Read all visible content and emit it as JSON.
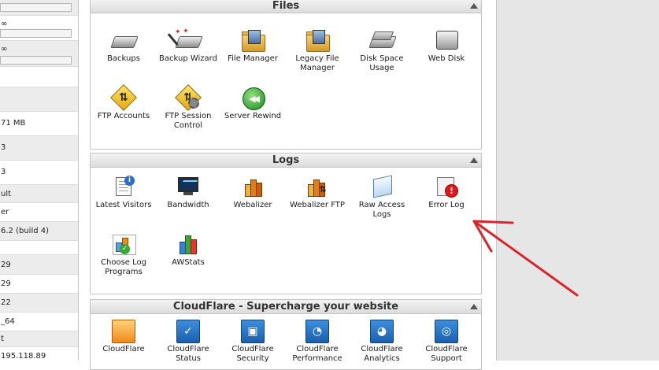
{
  "sidebar": {
    "rows": [
      {
        "text": "",
        "bar": 0.0
      },
      {
        "text": "∞",
        "bar": 0.0
      },
      {
        "text": "∞",
        "bar": 0.0
      },
      {
        "text": ""
      },
      {
        "text": ""
      },
      {
        "text": "71 MB"
      },
      {
        "text": "3"
      },
      {
        "text": "3"
      },
      {
        "text": "ult"
      },
      {
        "text": "er"
      },
      {
        "text": "6.2 (build 4)"
      },
      {
        "text": ""
      },
      {
        "text": "29"
      },
      {
        "text": "29"
      },
      {
        "text": "22"
      },
      {
        "text": "_64"
      },
      {
        "text": "t"
      },
      {
        "text": "195.118.89"
      }
    ]
  },
  "files": {
    "title": "Files",
    "items": [
      {
        "label": "Backups",
        "icon": "backups-icon"
      },
      {
        "label": "Backup Wizard",
        "icon": "backup-wizard-icon"
      },
      {
        "label": "File Manager",
        "icon": "file-manager-icon"
      },
      {
        "label": "Legacy File Manager",
        "icon": "legacy-file-manager-icon"
      },
      {
        "label": "Disk Space Usage",
        "icon": "disk-space-usage-icon"
      },
      {
        "label": "Web Disk",
        "icon": "web-disk-icon"
      },
      {
        "label": "FTP Accounts",
        "icon": "ftp-accounts-icon"
      },
      {
        "label": "FTP Session Control",
        "icon": "ftp-session-control-icon"
      },
      {
        "label": "Server Rewind",
        "icon": "server-rewind-icon"
      }
    ]
  },
  "logs": {
    "title": "Logs",
    "items": [
      {
        "label": "Latest Visitors",
        "icon": "latest-visitors-icon"
      },
      {
        "label": "Bandwidth",
        "icon": "bandwidth-icon"
      },
      {
        "label": "Webalizer",
        "icon": "webalizer-icon"
      },
      {
        "label": "Webalizer FTP",
        "icon": "webalizer-ftp-icon"
      },
      {
        "label": "Raw Access Logs",
        "icon": "raw-access-logs-icon"
      },
      {
        "label": "Error Log",
        "icon": "error-log-icon"
      },
      {
        "label": "Choose Log Programs",
        "icon": "choose-log-programs-icon"
      },
      {
        "label": "AWStats",
        "icon": "awstats-icon"
      }
    ]
  },
  "cloudflare": {
    "title": "CloudFlare - Supercharge your website",
    "items": [
      {
        "label": "CloudFlare",
        "icon": "cloudflare-icon"
      },
      {
        "label": "CloudFlare Status",
        "icon": "cloudflare-status-icon"
      },
      {
        "label": "CloudFlare Security",
        "icon": "cloudflare-security-icon"
      },
      {
        "label": "CloudFlare Performance",
        "icon": "cloudflare-performance-icon"
      },
      {
        "label": "CloudFlare Analytics",
        "icon": "cloudflare-analytics-icon"
      },
      {
        "label": "CloudFlare Support",
        "icon": "cloudflare-support-icon"
      }
    ]
  },
  "colors": {
    "annotation_arrow": "#d9252b",
    "panel_header": "#dcdcdc"
  }
}
